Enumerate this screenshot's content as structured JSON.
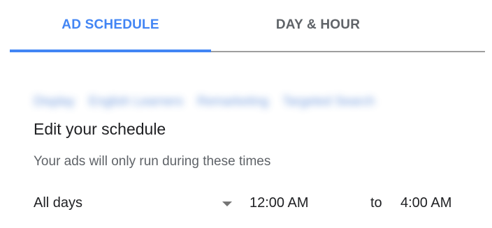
{
  "tabs": {
    "ad_schedule": "AD SCHEDULE",
    "day_hour": "DAY & HOUR",
    "selected": "AD SCHEDULE"
  },
  "colors": {
    "accent": "#4285f4",
    "tab_inactive": "#5f6368"
  },
  "blurred_campaigns": [
    "Display",
    "English Learners",
    "Remarketing",
    "Targeted Search"
  ],
  "editor": {
    "heading": "Edit your schedule",
    "subtitle": "Your ads will only run during these times"
  },
  "schedule_row": {
    "days": "All days",
    "dropdown_icon": "arrow-drop-down-icon",
    "start_time": "12:00 AM",
    "to_label": "to",
    "end_time": "4:00 AM"
  }
}
